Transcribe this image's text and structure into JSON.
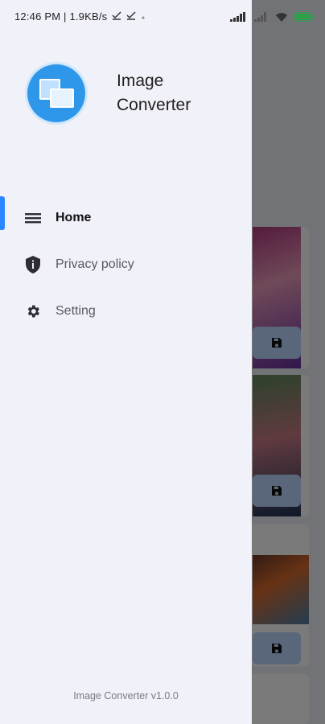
{
  "status_bar": {
    "time_network": "12:46 PM | 1.9KB/s",
    "icons": [
      "download-check-icon",
      "download-check-icon",
      "dot-icon",
      "signal-icon",
      "signal-icon",
      "wifi-icon",
      "battery-icon"
    ]
  },
  "drawer": {
    "app_name_line1": "Image",
    "app_name_line2": "Converter",
    "menu": [
      {
        "label": "Home",
        "icon": "menu-icon",
        "active": true
      },
      {
        "label": "Privacy policy",
        "icon": "shield-info-icon",
        "active": false
      },
      {
        "label": "Setting",
        "icon": "gear-icon",
        "active": false
      }
    ],
    "version": "Image Converter v1.0.0"
  },
  "colors": {
    "accent": "#2b86ff",
    "drawer_bg": "#f1f1f9",
    "logo": "#2f97ea"
  }
}
